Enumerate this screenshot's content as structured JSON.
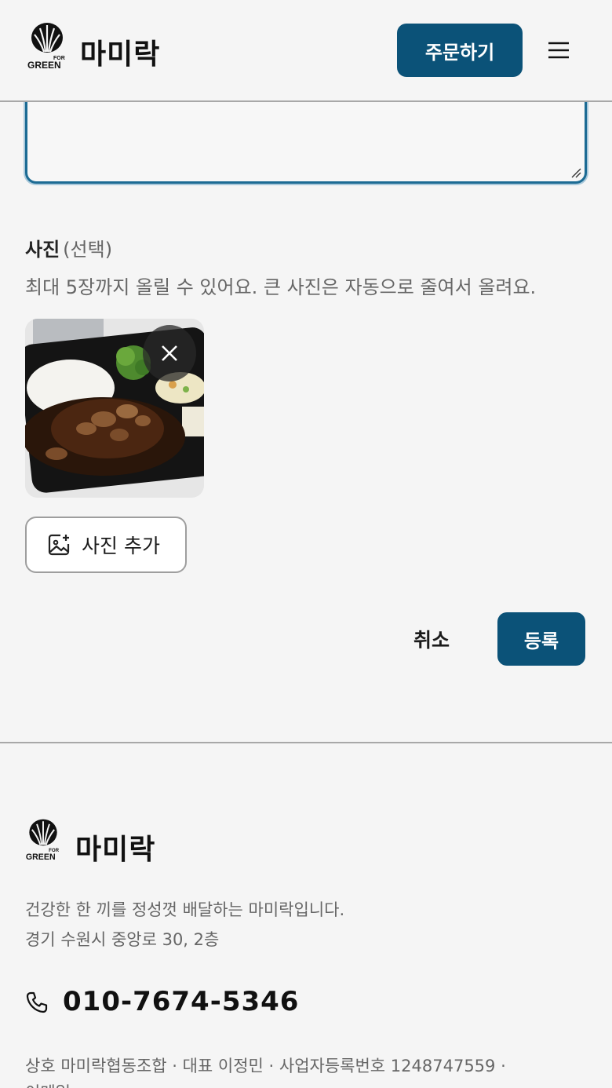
{
  "header": {
    "logo_text_for": "FOR",
    "logo_text_green": "GREEN",
    "brand": "마미락",
    "order_button": "주문하기",
    "menu_icon": "hamburger-menu-icon"
  },
  "form": {
    "photo_label": "사진",
    "photo_optional": "(선택)",
    "photo_help": "최대 5장까지 올릴 수 있어요. 큰 사진은 자동으로 줄여서 올려요.",
    "thumbnail_icon": "meal-photo-thumbnail",
    "remove_icon": "close-icon",
    "add_photo_label": "사진 추가",
    "add_photo_icon": "add-image-icon",
    "cancel_label": "취소",
    "submit_label": "등록"
  },
  "footer": {
    "brand": "마미락",
    "tagline": "건강한 한 끼를 정성껏 배달하는 마미락입니다.",
    "address": "경기 수원시 중앙로 30, 2층",
    "phone": "010-7674-5346",
    "business_info": "상호 마미락협동조합 · 대표 이정민 · 사업자등록번호 1248747559 ·",
    "business_info_2": "이메일"
  },
  "colors": {
    "primary": "#0b5278",
    "background": "#f5f5f5",
    "muted_text": "#666666"
  }
}
